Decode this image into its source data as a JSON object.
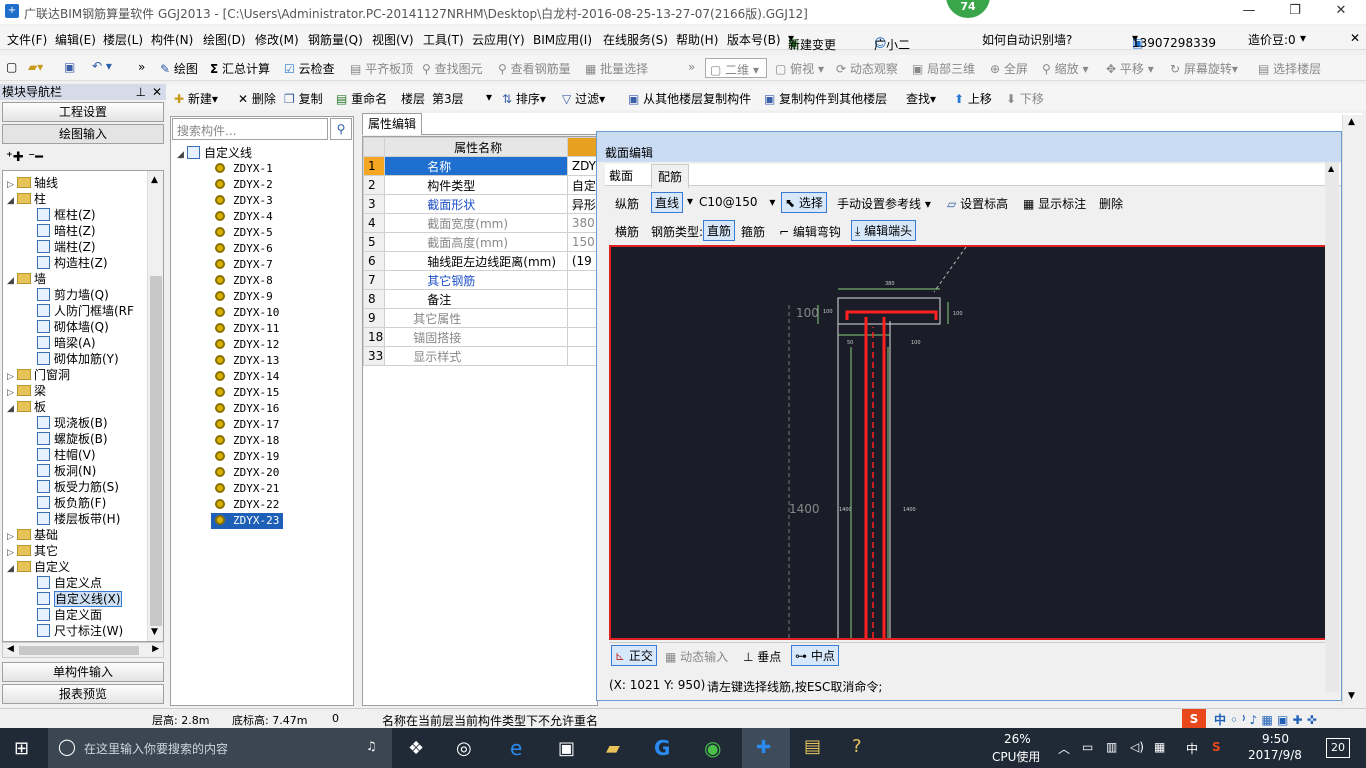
{
  "window": {
    "title": "广联达BIM钢筋算量软件 GGJ2013 - [C:\\Users\\Administrator.PC-20141127NRHM\\Desktop\\白龙村-2016-08-25-13-27-07(2166版).GGJ12]",
    "badge": "74"
  },
  "menu": [
    "文件(F)",
    "编辑(E)",
    "楼层(L)",
    "构件(N)",
    "绘图(D)",
    "修改(M)",
    "钢筋量(Q)",
    "视图(V)",
    "工具(T)",
    "云应用(Y)",
    "BIM应用(I)",
    "在线服务(S)",
    "帮助(H)",
    "版本号(B)",
    "新建变更",
    "广小二",
    "如何自动识别墙?",
    "13907298339",
    "造价豆:0"
  ],
  "toolbar1": {
    "draw": "绘图",
    "sum": "汇总计算",
    "cloud_check": "云检查",
    "level_slab": "平齐板顶",
    "find_elem": "查找图元",
    "view_rebar": "查看钢筋量",
    "batch_select": "批量选择",
    "view_mode": "二维",
    "top_view": "俯视",
    "dynamic_view": "动态观察",
    "local_3d": "局部三维",
    "full_screen": "全屏",
    "zoom": "缩放",
    "pan": "平移",
    "rotate": "屏幕旋转",
    "select_floor": "选择楼层"
  },
  "toolbar2": {
    "new": "新建",
    "delete": "删除",
    "copy": "复制",
    "rename": "重命名",
    "floor_label": "楼层",
    "floor_value": "第3层",
    "sort": "排序",
    "filter": "过滤",
    "copy_from": "从其他楼层复制构件",
    "copy_to": "复制构件到其他楼层",
    "find": "查找",
    "up": "上移",
    "down": "下移"
  },
  "nav": {
    "title": "模块导航栏",
    "project_settings": "工程设置",
    "draw_input": "绘图输入",
    "single_input": "单构件输入",
    "report_preview": "报表预览",
    "tree": [
      {
        "label": "轴线",
        "level": 0,
        "expander": "▷"
      },
      {
        "label": "柱",
        "level": 0,
        "expander": "◢"
      },
      {
        "label": "框柱(Z)",
        "level": 1
      },
      {
        "label": "暗柱(Z)",
        "level": 1
      },
      {
        "label": "端柱(Z)",
        "level": 1
      },
      {
        "label": "构造柱(Z)",
        "level": 1
      },
      {
        "label": "墙",
        "level": 0,
        "expander": "◢"
      },
      {
        "label": "剪力墙(Q)",
        "level": 1
      },
      {
        "label": "人防门框墙(RF",
        "level": 1
      },
      {
        "label": "砌体墙(Q)",
        "level": 1
      },
      {
        "label": "暗梁(A)",
        "level": 1
      },
      {
        "label": "砌体加筋(Y)",
        "level": 1
      },
      {
        "label": "门窗洞",
        "level": 0,
        "expander": "▷"
      },
      {
        "label": "梁",
        "level": 0,
        "expander": "▷"
      },
      {
        "label": "板",
        "level": 0,
        "expander": "◢"
      },
      {
        "label": "现浇板(B)",
        "level": 1
      },
      {
        "label": "螺旋板(B)",
        "level": 1
      },
      {
        "label": "柱帽(V)",
        "level": 1
      },
      {
        "label": "板洞(N)",
        "level": 1
      },
      {
        "label": "板受力筋(S)",
        "level": 1
      },
      {
        "label": "板负筋(F)",
        "level": 1
      },
      {
        "label": "楼层板带(H)",
        "level": 1
      },
      {
        "label": "基础",
        "level": 0,
        "expander": "▷"
      },
      {
        "label": "其它",
        "level": 0,
        "expander": "▷"
      },
      {
        "label": "自定义",
        "level": 0,
        "expander": "◢"
      },
      {
        "label": "自定义点",
        "level": 1
      },
      {
        "label": "自定义线(X)",
        "level": 1,
        "selected": true
      },
      {
        "label": "自定义面",
        "level": 1
      },
      {
        "label": "尺寸标注(W)",
        "level": 1
      }
    ]
  },
  "components": {
    "search_placeholder": "搜索构件...",
    "root": "自定义线",
    "items": [
      "ZDYX-1",
      "ZDYX-2",
      "ZDYX-3",
      "ZDYX-4",
      "ZDYX-5",
      "ZDYX-6",
      "ZDYX-7",
      "ZDYX-8",
      "ZDYX-9",
      "ZDYX-10",
      "ZDYX-11",
      "ZDYX-12",
      "ZDYX-13",
      "ZDYX-14",
      "ZDYX-15",
      "ZDYX-16",
      "ZDYX-17",
      "ZDYX-18",
      "ZDYX-19",
      "ZDYX-20",
      "ZDYX-21",
      "ZDYX-22",
      "ZDYX-23"
    ],
    "selected": "ZDYX-23"
  },
  "props": {
    "tab": "属性编辑",
    "header": "属性名称",
    "rows": [
      {
        "no": "1",
        "name": "名称",
        "value": "ZDY",
        "style": "sel"
      },
      {
        "no": "2",
        "name": "构件类型",
        "value": "自定",
        "style": ""
      },
      {
        "no": "3",
        "name": "截面形状",
        "value": "异形",
        "style": "blue"
      },
      {
        "no": "4",
        "name": "截面宽度(mm)",
        "value": "380",
        "style": "gray"
      },
      {
        "no": "5",
        "name": "截面高度(mm)",
        "value": "150",
        "style": "gray"
      },
      {
        "no": "6",
        "name": "轴线距左边线距离(mm)",
        "value": "(19",
        "style": ""
      },
      {
        "no": "7",
        "name": "其它钢筋",
        "value": "",
        "style": "blue"
      },
      {
        "no": "8",
        "name": "备注",
        "value": "",
        "style": ""
      },
      {
        "no": "9",
        "name": "其它属性",
        "value": "",
        "style": "grayplus"
      },
      {
        "no": "18",
        "name": "锚固搭接",
        "value": "",
        "style": "grayplus"
      },
      {
        "no": "33",
        "name": "显示样式",
        "value": "",
        "style": "grayplus"
      }
    ]
  },
  "dialog": {
    "title": "截面编辑",
    "tabs": [
      "截面",
      "配筋"
    ],
    "row1": {
      "long_bar": "纵筋",
      "line": "直线",
      "spec": "C10@150",
      "select": "选择",
      "manual_ref": "手动设置参考线",
      "set_elev": "设置标高",
      "show_label": "显示标注",
      "delete": "删除"
    },
    "row2": {
      "stirrup": "横筋",
      "bar_type_label": "钢筋类型:",
      "straight": "直筋",
      "hoop": "箍筋",
      "edit_hook": "编辑弯钩",
      "edit_end": "编辑端头"
    },
    "snap": {
      "ortho": "正交",
      "dynamic": "动态输入",
      "perp": "垂点",
      "mid": "中点"
    },
    "coords": "(X: 1021 Y: 950)",
    "prompt": "请左键选择线筋,按ESC取消命令;",
    "dims": {
      "top": "380",
      "left": "100",
      "right": "100",
      "left_small": "100",
      "bot_left": "50",
      "bot_right": "100",
      "height": "1400",
      "inner_left": "1400",
      "inner_right": "1400"
    }
  },
  "status": {
    "floor_h": "层高: 2.8m",
    "bottom_h": "底标高: 7.47m",
    "zero": "0",
    "message": "名称在当前层当前构件类型下不允许重名"
  },
  "taskbar": {
    "search": "在这里输入你要搜索的内容",
    "cpu_pct": "26%",
    "cpu_label": "CPU使用",
    "ime": "中",
    "time": "9:50",
    "date": "2017/9/8",
    "notif": "20"
  }
}
